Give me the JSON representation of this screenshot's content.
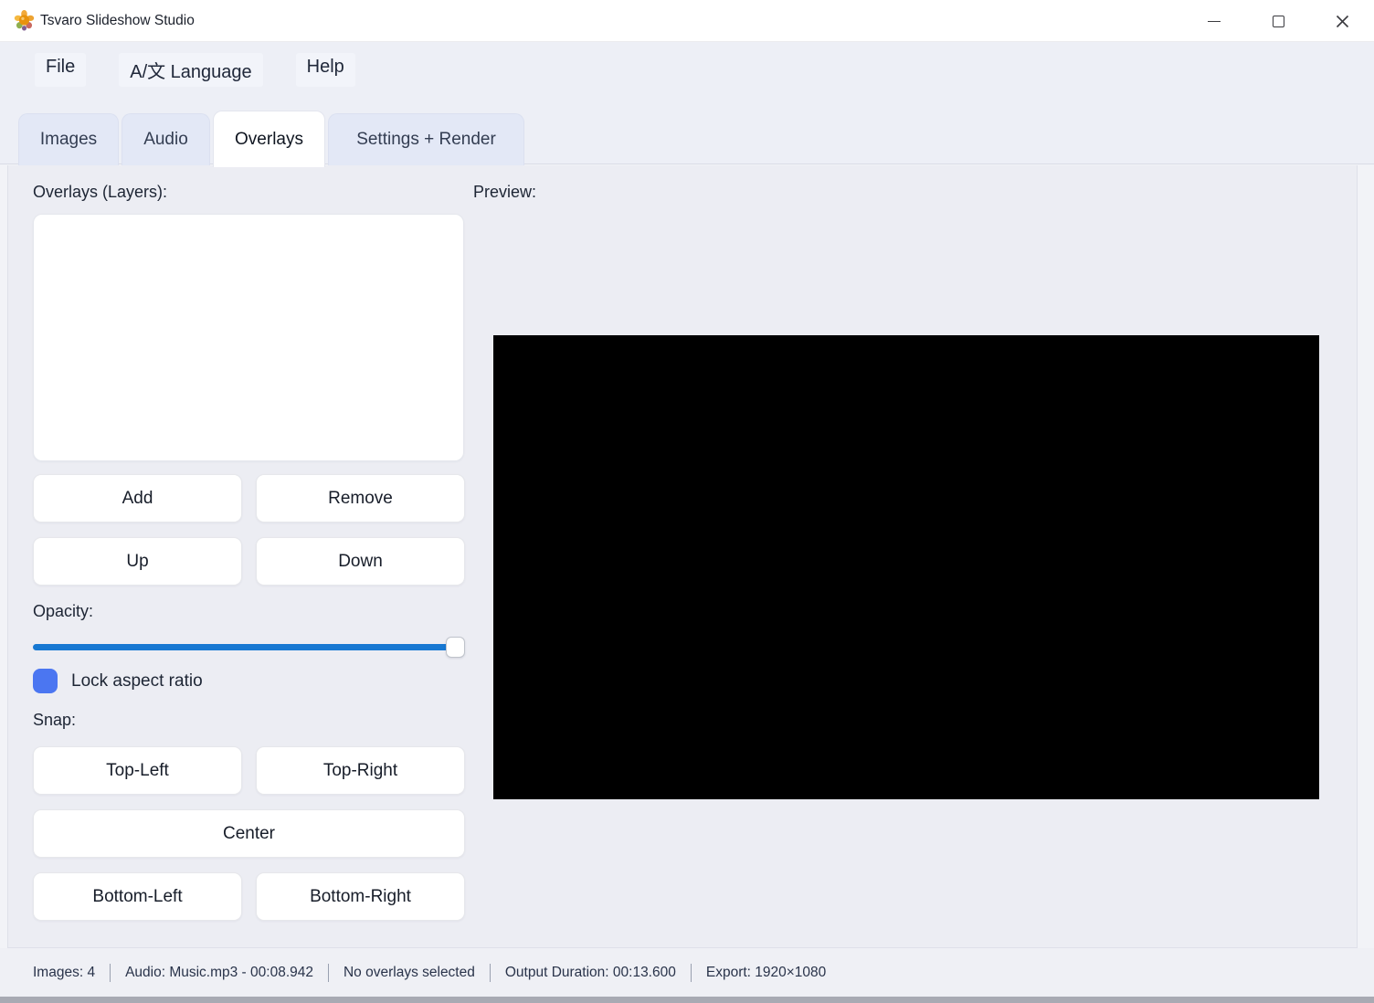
{
  "window": {
    "title": "Tsvaro Slideshow Studio"
  },
  "menu": {
    "items": [
      "File",
      "A/文 Language",
      "Help"
    ]
  },
  "tabs": [
    {
      "label": "Images",
      "active": false
    },
    {
      "label": "Audio",
      "active": false
    },
    {
      "label": "Overlays",
      "active": true
    },
    {
      "label": "Settings + Render",
      "active": false
    }
  ],
  "overlays_panel": {
    "heading": "Overlays (Layers):",
    "list_items": [],
    "add_label": "Add",
    "remove_label": "Remove",
    "up_label": "Up",
    "down_label": "Down",
    "opacity_label": "Opacity:",
    "opacity_percent": 100,
    "lock_aspect_label": "Lock aspect ratio",
    "lock_aspect_checked": true,
    "snap_label": "Snap:",
    "snap_buttons": [
      "Top-Left",
      "Top-Right",
      "Center",
      "Bottom-Left",
      "Bottom-Right"
    ]
  },
  "preview_panel": {
    "heading": "Preview:"
  },
  "status_bar": {
    "items": [
      "Images: 4",
      "Audio: Music.mp3 - 00:08.942",
      "No overlays selected",
      "Output Duration: 00:13.600",
      "Export: 1920×1080"
    ]
  },
  "colors": {
    "slider_blue": "#1778d2",
    "checkbox_blue": "#4b76f1",
    "preview_bg": "#000000",
    "active_tab_bg": "#ffffff",
    "inactive_tab_bg": "#e3e8f6"
  }
}
